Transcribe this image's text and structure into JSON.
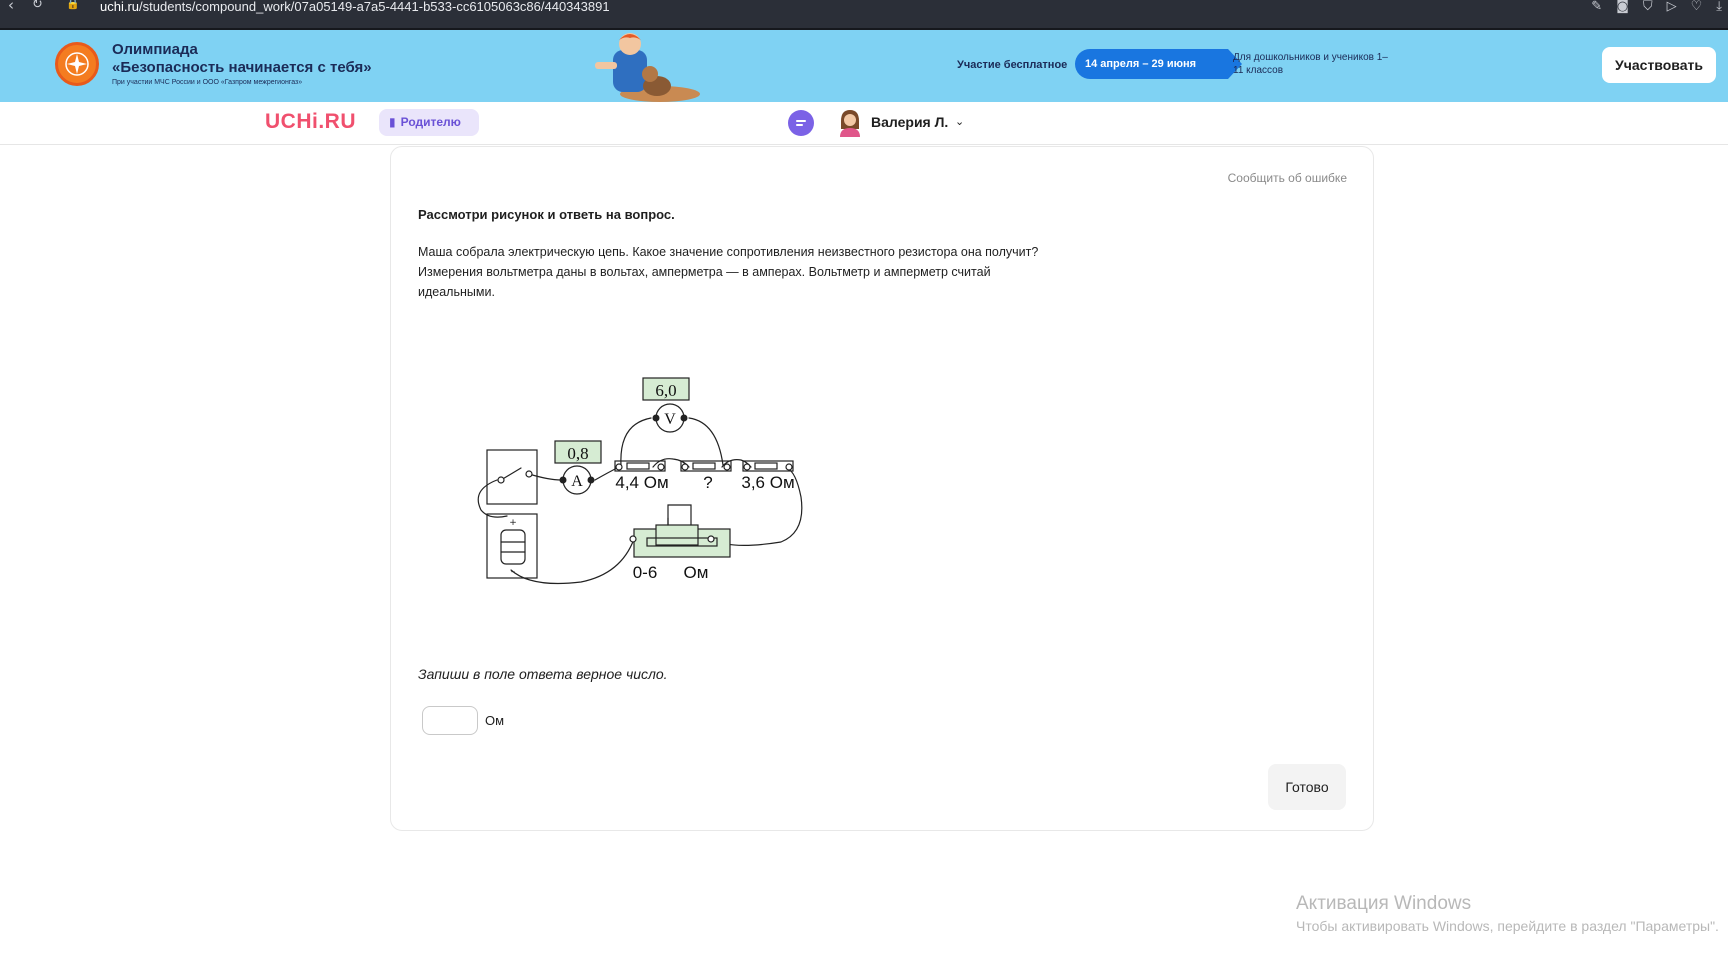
{
  "browser": {
    "url_host": "uchi.ru",
    "url_path": "/students/compound_work/07a05149-a7a5-4441-b533-cc6105063c86/440343891",
    "icons": [
      "back-icon",
      "reload-icon",
      "lock-icon",
      "edit-icon",
      "camera-icon",
      "shield-icon",
      "play-icon",
      "heart-icon",
      "download-icon"
    ]
  },
  "promo": {
    "title_line1": "Олимпиада",
    "title_line2": "«Безопасность начинается с тебя»",
    "subtitle": "При участии МЧС России и ООО «Газпром межрегионгаз»",
    "free": "Участие бесплатное",
    "dates": "14 апреля – 29 июня",
    "audience": "Для дошкольников и учеников 1–11 классов",
    "cta": "Участвовать"
  },
  "header": {
    "logo": "UCHi.RU",
    "parent_label": "Родителю",
    "user_name": "Валерия Л."
  },
  "task": {
    "report_error": "Сообщить об ошибке",
    "title": "Рассмотри рисунок и ответь на вопрос.",
    "text": "Маша собрала электрическую цепь. Какое значение сопротивления неизвестного резистора она получит? Измерения вольтметра даны в вольтах, амперметра — в амперах. Вольтметр и амперметр считай идеальными.",
    "instruction": "Запиши в поле ответа верное число.",
    "answer_value": "",
    "unit": "Ом",
    "done": "Готово"
  },
  "circuit": {
    "voltmeter_reading": "6,0",
    "ammeter_reading": "0,8",
    "voltmeter_symbol": "V",
    "ammeter_symbol": "A",
    "resistor1": "4,4 Ом",
    "resistor2": "?",
    "resistor3": "3,6 Ом",
    "rheostat_range": "0-6",
    "rheostat_unit": "Ом",
    "battery_plus": "+",
    "battery_minus": "–",
    "colors": {
      "reading_bg": "#d6ecd3",
      "stroke": "#222222"
    }
  },
  "watermark": {
    "title": "Активация Windows",
    "text": "Чтобы активировать Windows, перейдите в раздел \"Параметры\"."
  }
}
